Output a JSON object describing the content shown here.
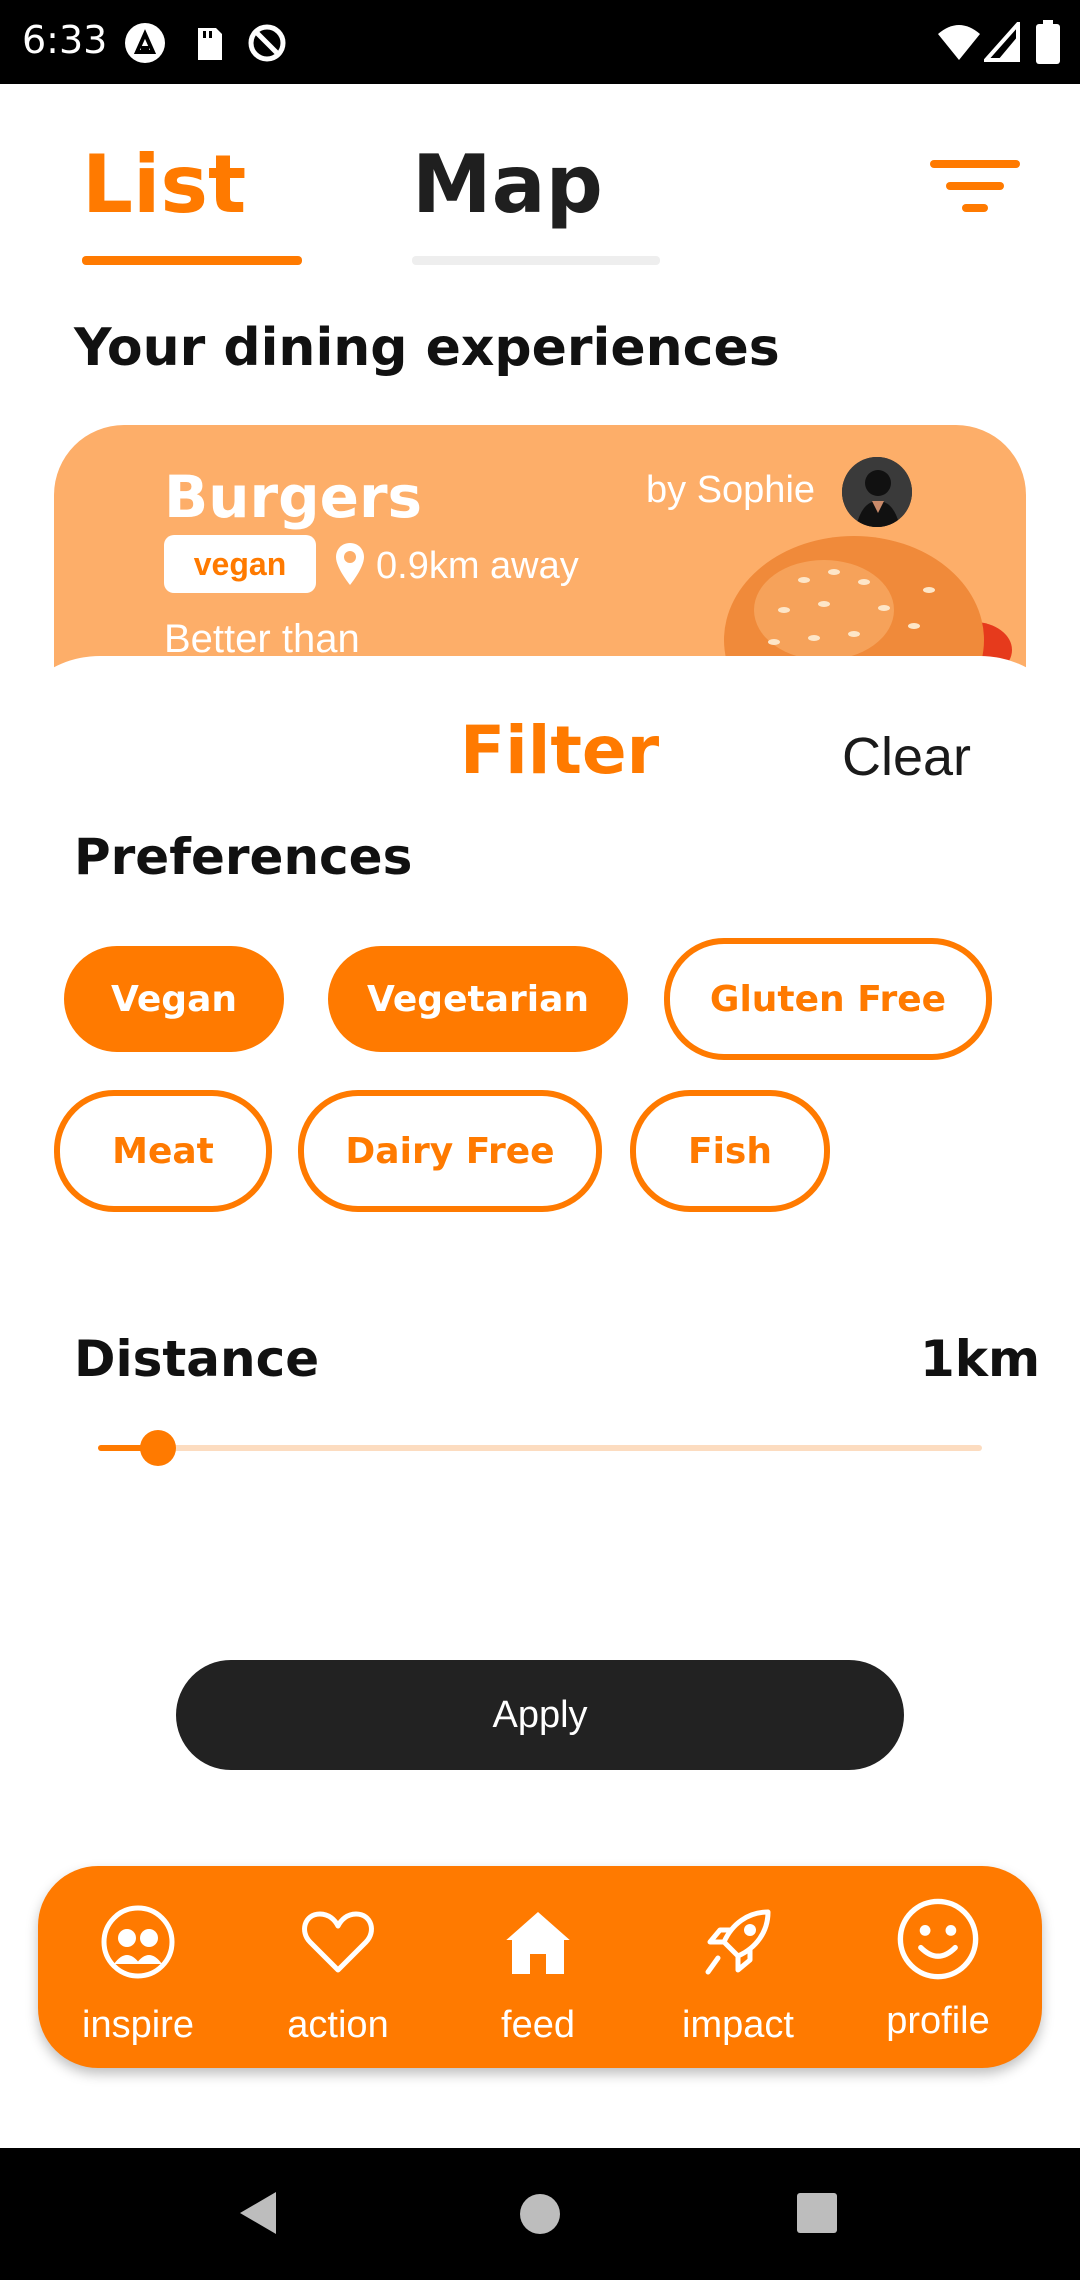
{
  "status_bar": {
    "time": "6:33"
  },
  "tabs": {
    "list_label": "List",
    "map_label": "Map"
  },
  "section_title": "Your dining experiences",
  "card": {
    "title": "Burgers",
    "author": "by Sophie",
    "tag": "vegan",
    "distance": "0.9km away",
    "description": "Better than"
  },
  "filter": {
    "title": "Filter",
    "clear_label": "Clear",
    "preferences_title": "Preferences",
    "chips": [
      {
        "label": "Vegan",
        "selected": true
      },
      {
        "label": "Vegetarian",
        "selected": true
      },
      {
        "label": "Gluten Free",
        "selected": false
      },
      {
        "label": "Meat",
        "selected": false
      },
      {
        "label": "Dairy Free",
        "selected": false
      },
      {
        "label": "Fish",
        "selected": false
      }
    ],
    "distance_label": "Distance",
    "distance_value": "1km",
    "distance_slider_fraction": 0.1,
    "apply_label": "Apply"
  },
  "nav": {
    "items": [
      {
        "label": "inspire",
        "icon": "inspire-icon"
      },
      {
        "label": "action",
        "icon": "heart-icon"
      },
      {
        "label": "feed",
        "icon": "home-icon"
      },
      {
        "label": "impact",
        "icon": "rocket-icon"
      },
      {
        "label": "profile",
        "icon": "smiley-icon"
      }
    ]
  },
  "colors": {
    "accent": "#FF7A00",
    "card": "#FDAE69",
    "dark": "#222222"
  }
}
